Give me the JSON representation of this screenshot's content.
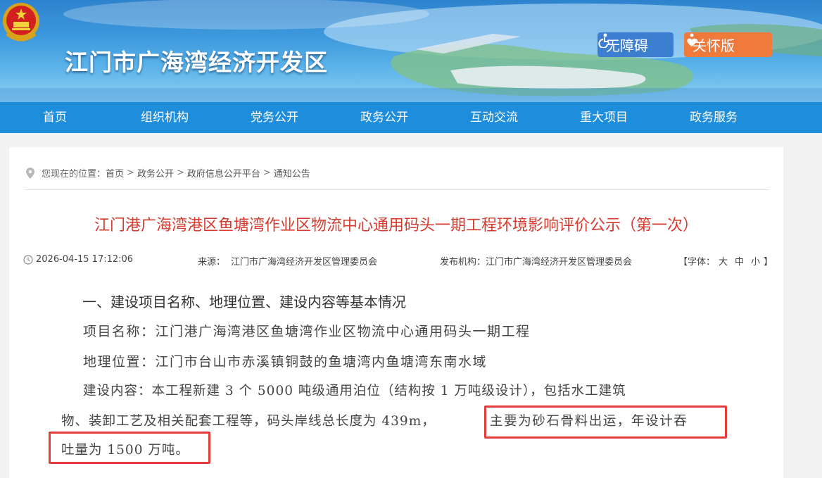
{
  "header": {
    "site_title": "江门市广海湾经济开发区",
    "accessibility_label": "无障碍",
    "care_label": "关怀版"
  },
  "nav": {
    "items": [
      "首页",
      "组织机构",
      "党务公开",
      "政务公开",
      "互动交流",
      "重大项目",
      "政务服务"
    ]
  },
  "breadcrumb": {
    "prefix": "您现在的位置：",
    "items": [
      "首页",
      "政务公开",
      "政府信息公开平台",
      "通知公告"
    ]
  },
  "article": {
    "title": "江门港广海湾港区鱼塘湾作业区物流中心通用码头一期工程环境影响评价公示（第一次）",
    "date": "2026-04-15 17:12:06",
    "source_label": "来源：",
    "source": "江门市广海湾经济开发区管理委员会",
    "publisher_label": "发布机构：",
    "publisher": "江门市广海湾经济开发区管理委员会",
    "font_label_open": "【字体：",
    "font_sizes": [
      "大",
      "中",
      "小"
    ],
    "font_label_close": "】",
    "section_heading": "一、建设项目名称、地理位置、建设内容等基本情况",
    "line_project": "项目名称：江门港广海湾港区鱼塘湾作业区物流中心通用码头一期工程",
    "line_location": "地理位置：江门市台山市赤溪镇铜鼓的鱼塘湾内鱼塘湾东南水域",
    "line_content_1": "建设内容：本工程新建 3 个 5000 吨级通用泊位（结构按 1 万吨级设计），包括水工建筑",
    "line_content_2a": "物、装卸工艺及相关配套工程等，码头岸线总长度为 439m，",
    "line_content_2b": "主要为砂石骨料出运，年设计吞",
    "line_content_3": "吐量为 1500 万吨。"
  },
  "colors": {
    "nav_bg": "#1d8ddc",
    "title_red": "#d53b2e",
    "highlight_red": "#e43b3b",
    "care_orange": "#f07a3c",
    "a11y_blue": "#3c7fd0"
  }
}
